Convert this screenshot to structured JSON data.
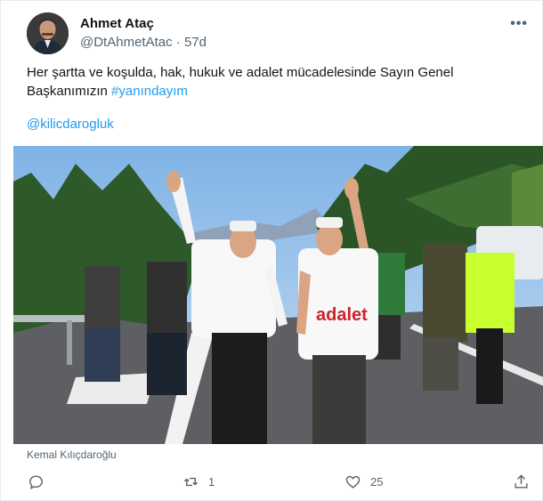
{
  "tweet": {
    "author_name": "Ahmet Ataç",
    "handle": "@DtAhmetAtac",
    "separator": "·",
    "time": "57d",
    "text_part1": "Her şartta ve koşulda, hak, hukuk ve adalet mücadelesinde Sayın Genel Başkanımızın ",
    "hashtag": "#yanındayım",
    "mention": "@kilicdarogluk",
    "media_caption": "Kemal Kılıçdaroğlu",
    "photo_shirt_text": "adalet",
    "more_label": "•••"
  },
  "actions": {
    "reply_count": "",
    "retweet_count": "1",
    "like_count": "25",
    "share_count": ""
  },
  "icons": {
    "more": "more-icon",
    "reply": "reply-icon",
    "retweet": "retweet-icon",
    "like": "heart-icon",
    "share": "share-icon"
  },
  "colors": {
    "link": "#1d9bf0",
    "secondary_text": "#536471",
    "primary_text": "#0f1419"
  }
}
